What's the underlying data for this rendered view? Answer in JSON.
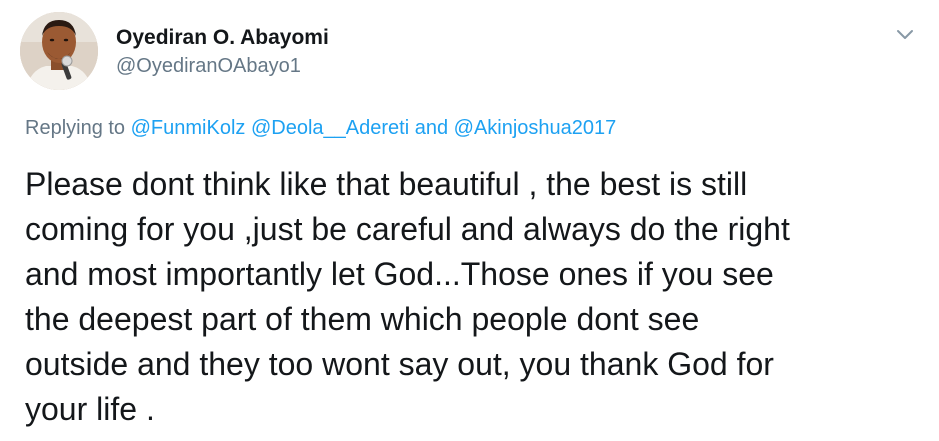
{
  "tweet": {
    "author": {
      "display_name": "Oyediran O. Abayomi",
      "handle": "@OyediranOAbayo1"
    },
    "menu_icon": "chevron-down-icon",
    "replying": {
      "prefix": "Replying to",
      "mention_1": "@FunmiKolz",
      "mention_2": "@Deola__Adereti",
      "conjunction": "and",
      "mention_3": "@Akinjoshua2017"
    },
    "body_lines": [
      "Please dont think like that beautiful , the best is still",
      "coming for you ,just be careful and always do the right",
      "and most importantly let God...Those ones if you see",
      "the deepest part of them which people dont see",
      "outside and they too wont say out, you thank God for",
      "your life ."
    ],
    "colors": {
      "link": "#1da1f2",
      "secondary_text": "#657786",
      "primary_text": "#14171a"
    }
  }
}
